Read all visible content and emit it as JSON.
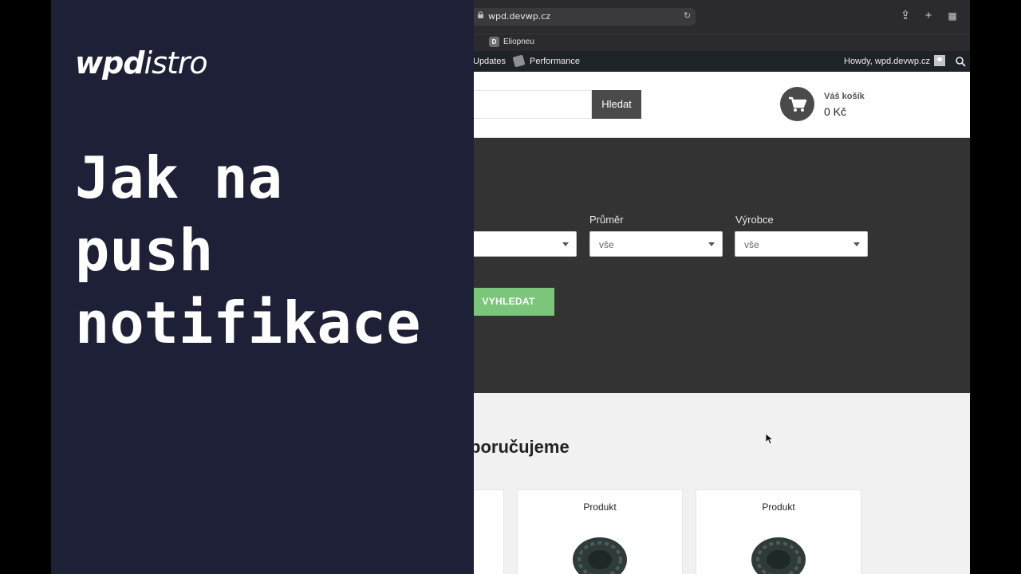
{
  "panel": {
    "brand_bold": "wpd",
    "brand_regular": "istro",
    "headline_line1": "Jak na",
    "headline_line2": "push",
    "headline_line3": "notifikace"
  },
  "browser": {
    "url": "wpd.devwp.cz",
    "bookmark_icon_letter": "D",
    "bookmark_label": "Eliopneu",
    "toolbar_icons": [
      "share-icon",
      "new-tab-icon",
      "tab-overview-icon"
    ]
  },
  "admin_bar": {
    "updates_label": "Updates",
    "performance_label": "Performance",
    "greeting": "Howdy, wpd.devwp.cz"
  },
  "header": {
    "search_button": "Hledat",
    "cart_label": "Váš košík",
    "cart_total": "0 Kč"
  },
  "filters": {
    "diameter_label": "Průměr",
    "diameter_value": "vše",
    "manufacturer_label": "Výrobce",
    "manufacturer_value": "vše",
    "search_button": "VYHLEDAT"
  },
  "recommend": {
    "title": "poručujeme",
    "products": [
      {
        "name": "Produkt"
      },
      {
        "name": "Produkt"
      }
    ]
  }
}
